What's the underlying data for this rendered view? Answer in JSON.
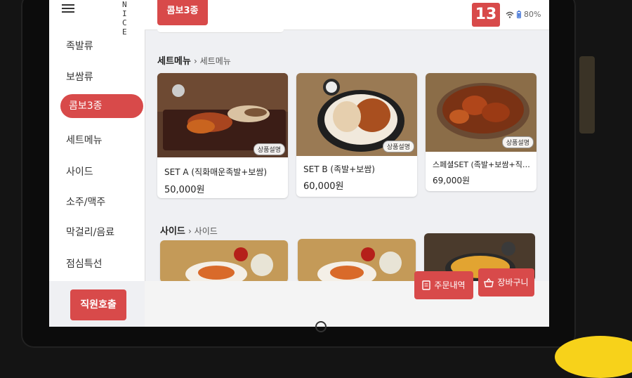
{
  "sidebar": {
    "logo": "NI CE",
    "items": [
      {
        "label": "족발류",
        "active": false
      },
      {
        "label": "보쌈류",
        "active": false
      },
      {
        "label": "콤보3종",
        "active": true
      },
      {
        "label": "세트메뉴",
        "active": false
      },
      {
        "label": "사이드",
        "active": false
      },
      {
        "label": "소주/맥주",
        "active": false
      },
      {
        "label": "막걸리/음료",
        "active": false
      },
      {
        "label": "점심특선",
        "active": false
      }
    ],
    "staff_call": "직원호출"
  },
  "topbar": {
    "current_category": "콤보3종",
    "table_number": "13",
    "battery": "80%"
  },
  "sections": [
    {
      "title": "세트메뉴",
      "subtitle": "세트메뉴",
      "items": [
        {
          "name": "SET A (직화매운족발+보쌈)",
          "price": "50,000원",
          "badge": "상품설명"
        },
        {
          "name": "SET B (족발+보쌈)",
          "price": "60,000원",
          "badge": "상품설명"
        },
        {
          "name": "스페셜SET (족발+보쌈+직…",
          "price": "69,000원",
          "badge": "상품설명"
        }
      ]
    },
    {
      "title": "사이드",
      "subtitle": "사이드",
      "items": [
        {},
        {},
        {}
      ]
    }
  ],
  "bottom": {
    "order_history": "주문내역",
    "cart": "장바구니"
  },
  "colors": {
    "accent": "#d84a4a",
    "background": "#eff0f3"
  }
}
